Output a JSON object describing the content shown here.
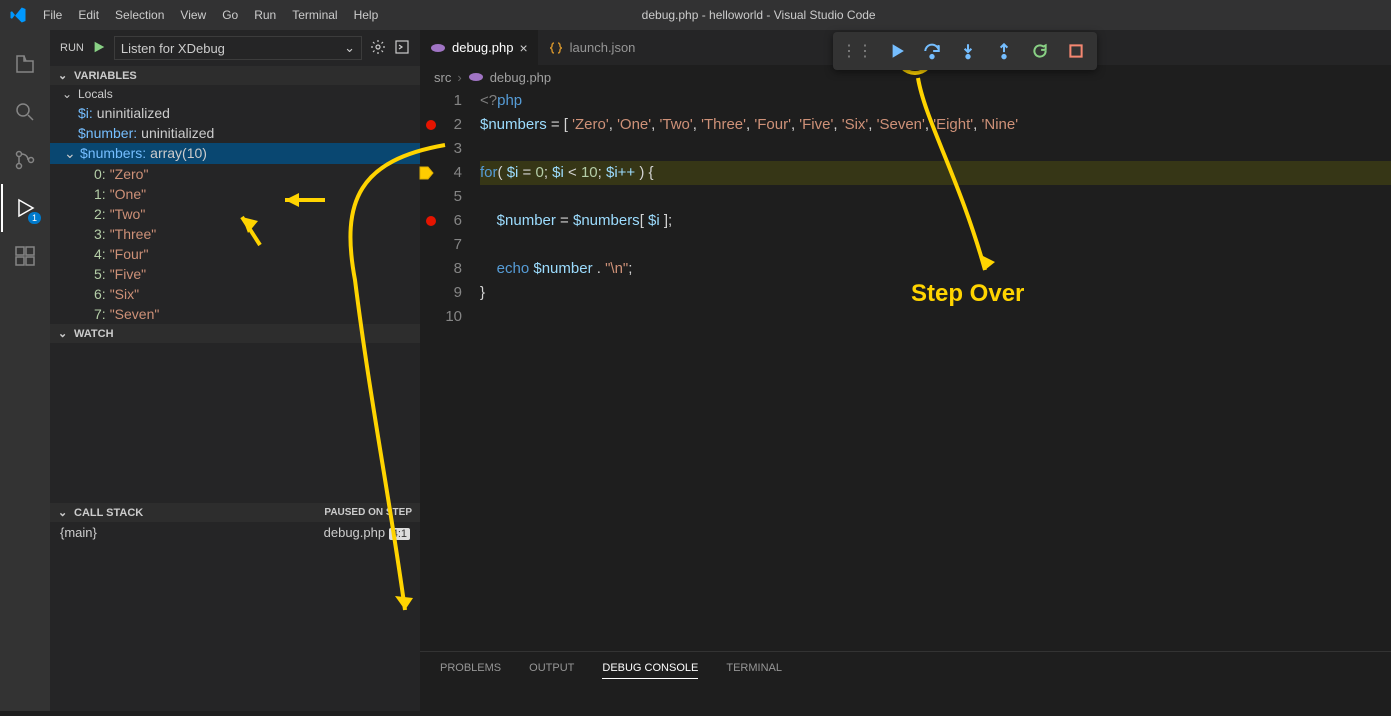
{
  "titlebar": {
    "menus": [
      "File",
      "Edit",
      "Selection",
      "View",
      "Go",
      "Run",
      "Terminal",
      "Help"
    ],
    "title": "debug.php - helloworld - Visual Studio Code"
  },
  "activitybar": {
    "debug_badge": "1"
  },
  "run": {
    "label": "RUN",
    "config": "Listen for XDebug"
  },
  "variables": {
    "header": "VARIABLES",
    "locals_label": "Locals",
    "i": {
      "name": "$i:",
      "val": "uninitialized"
    },
    "number": {
      "name": "$number:",
      "val": "uninitialized"
    },
    "numbers": {
      "name": "$numbers:",
      "val": "array(10)"
    },
    "items": [
      {
        "k": "0:",
        "v": "\"Zero\""
      },
      {
        "k": "1:",
        "v": "\"One\""
      },
      {
        "k": "2:",
        "v": "\"Two\""
      },
      {
        "k": "3:",
        "v": "\"Three\""
      },
      {
        "k": "4:",
        "v": "\"Four\""
      },
      {
        "k": "5:",
        "v": "\"Five\""
      },
      {
        "k": "6:",
        "v": "\"Six\""
      },
      {
        "k": "7:",
        "v": "\"Seven\""
      }
    ]
  },
  "watch": {
    "header": "WATCH"
  },
  "callstack": {
    "header": "CALL STACK",
    "status": "PAUSED ON STEP",
    "frame": "{main}",
    "file": "debug.php",
    "loc": "4:1"
  },
  "tabs": {
    "debug": "debug.php",
    "launch": "launch.json"
  },
  "breadcrumb": {
    "src": "src",
    "file": "debug.php"
  },
  "code": {
    "lines": [
      "1",
      "2",
      "3",
      "4",
      "5",
      "6",
      "7",
      "8",
      "9",
      "10"
    ],
    "l1a": "<?",
    "l1b": "php",
    "l2a": "$numbers",
    "l2b": " = [ ",
    "l2c": "'Zero'",
    "l2d": ", ",
    "l2e": "'One'",
    "l2f": ", ",
    "l2g": "'Two'",
    "l2h": ", ",
    "l2i": "'Three'",
    "l2j": ", ",
    "l2k": "'Four'",
    "l2l": ", ",
    "l2m": "'Five'",
    "l2n": ", ",
    "l2o": "'Six'",
    "l2p": ", ",
    "l2q": "'Seven'",
    "l2r": ", ",
    "l2s": "'Eight'",
    "l2t": ", ",
    "l2u": "'Nine'",
    "l4a": "for",
    "l4b": "( ",
    "l4c": "$i",
    "l4d": " = ",
    "l4e": "0",
    "l4f": "; ",
    "l4g": "$i",
    "l4h": " < ",
    "l4i": "10",
    "l4j": "; ",
    "l4k": "$i++",
    "l4l": " ) {",
    "l6a": "    ",
    "l6b": "$number",
    "l6c": " = ",
    "l6d": "$numbers",
    "l6e": "[ ",
    "l6f": "$i",
    "l6g": " ];",
    "l8a": "    ",
    "l8b": "echo",
    "l8c": " ",
    "l8d": "$number",
    "l8e": " . ",
    "l8f": "\"\\n\"",
    "l8g": ";",
    "l9": "}"
  },
  "bottom": {
    "problems": "PROBLEMS",
    "output": "OUTPUT",
    "debug": "DEBUG CONSOLE",
    "terminal": "TERMINAL"
  },
  "annotation": {
    "stepover": "Step Over"
  }
}
